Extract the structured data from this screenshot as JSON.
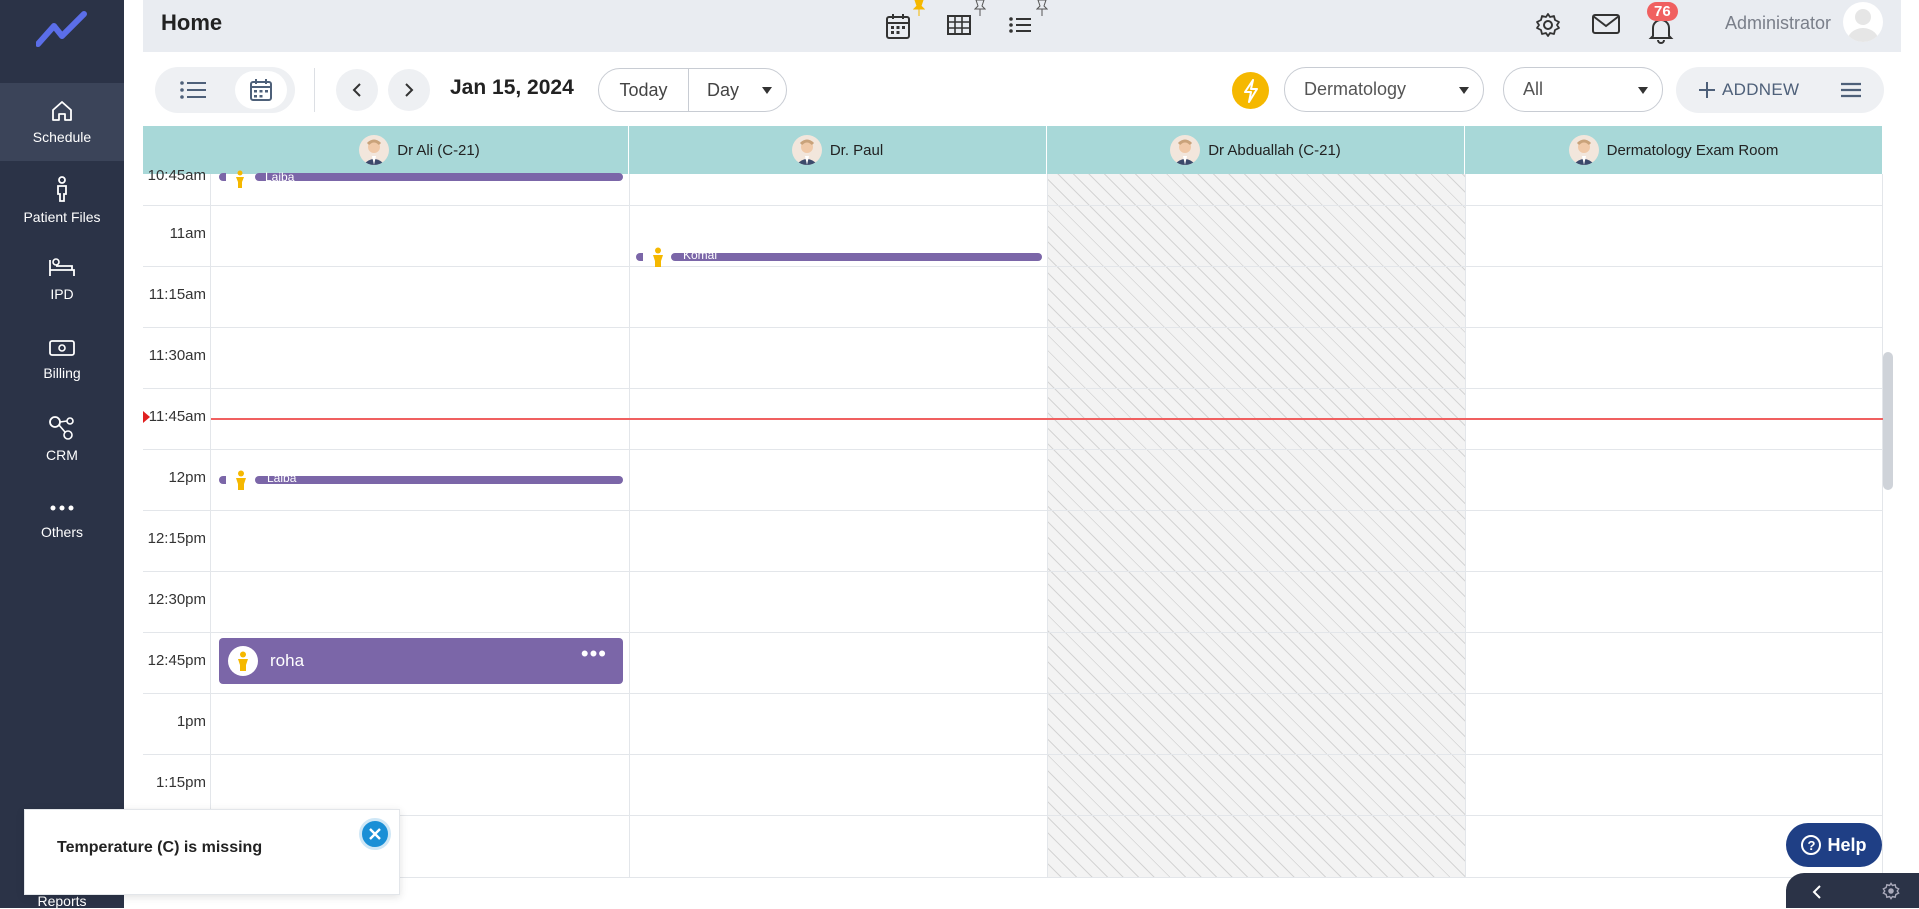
{
  "sidebar": {
    "items": [
      {
        "label": "Schedule",
        "icon": "home-icon"
      },
      {
        "label": "Patient Files",
        "icon": "patient-icon"
      },
      {
        "label": "IPD",
        "icon": "bed-icon"
      },
      {
        "label": "Billing",
        "icon": "billing-icon"
      },
      {
        "label": "CRM",
        "icon": "crm-icon"
      },
      {
        "label": "Others",
        "icon": "more-icon"
      }
    ],
    "reports_label": "Reports"
  },
  "header": {
    "title": "Home",
    "notification_count": "76",
    "user_name": "Administrator"
  },
  "toolbar": {
    "date": "Jan 15, 2024",
    "today_label": "Today",
    "view_mode": "Day",
    "department": "Dermatology",
    "filter": "All",
    "add_new_label": "ADDNEW"
  },
  "columns": [
    {
      "name": "Dr Ali (C-21)"
    },
    {
      "name": "Dr. Paul"
    },
    {
      "name": "Dr Abduallah (C-21)"
    },
    {
      "name": "Dermatology Exam Room"
    }
  ],
  "time_slots": [
    "10:45am",
    "11am",
    "11:15am",
    "11:30am",
    "11:45am",
    "12pm",
    "12:15pm",
    "12:30pm",
    "12:45pm",
    "1pm",
    "1:15pm"
  ],
  "appointments": [
    {
      "patient": "Laiba",
      "column": "Dr Ali (C-21)",
      "time": "10:45am"
    },
    {
      "patient": "Komal",
      "column": "Dr. Paul",
      "time": "11am"
    },
    {
      "patient": "Laiba",
      "column": "Dr Ali (C-21)",
      "time": "12pm"
    },
    {
      "patient": "roha",
      "column": "Dr Ali (C-21)",
      "time": "12:45pm"
    }
  ],
  "toast": {
    "message": "Temperature (C) is missing"
  },
  "help_label": "Help",
  "colors": {
    "sidebar_bg": "#2b3347",
    "column_header_bg": "#a8d8d8",
    "appointment": "#7b66a8",
    "accent_yellow": "#f5b800",
    "current_time_line": "#f06060",
    "badge": "#f06060",
    "help_button": "#1f3f85"
  }
}
